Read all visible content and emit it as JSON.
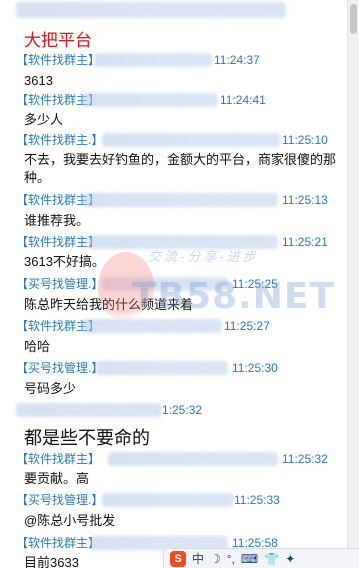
{
  "title": "大把平台",
  "watermark": {
    "brand": "TB58.NET",
    "slogan": "交流-分享-进步"
  },
  "ime_toolbar": {
    "logo": "S",
    "items": [
      "中",
      "☽",
      "°,",
      "⌨",
      "👕",
      "✦"
    ]
  },
  "messages": [
    {
      "sender": "【软件找群主】",
      "time": "11:24:37",
      "text": "3613"
    },
    {
      "sender": "【软件找群主】",
      "time": "11:24:41",
      "text": "多少人"
    },
    {
      "sender": "【软件找群主.】",
      "time": "11:25:10",
      "text": "不去，我要去好钓鱼的，金额大的平台，商家很傻的那种。"
    },
    {
      "sender": "【软件找群主】",
      "time": "11:25:13",
      "text": "谁推荐我。"
    },
    {
      "sender": "【软件找群主】",
      "time": "11:25:21",
      "text": "3613不好搞。"
    },
    {
      "sender": "【买号找管理.】",
      "time": "11:25:25",
      "text": "陈总昨天给我的什么频道来着"
    },
    {
      "sender": "【软件找群主】",
      "time": "11:25:27",
      "text": "哈哈"
    },
    {
      "sender": "【买号找管理.】",
      "time": "11:25:30",
      "text": "号码多少"
    },
    {
      "sender": "",
      "time": "1:25:32",
      "text": "都是些不要命的"
    },
    {
      "sender": "【软件找群主】",
      "time": "11:25:32",
      "text": "要贡献。高"
    },
    {
      "sender": "【买号找管理.】",
      "time": "11:25:33",
      "text": "@陈总小号批发"
    },
    {
      "sender": "【软件找群主】",
      "time": "11:25:58",
      "text": "目前3633"
    }
  ]
}
